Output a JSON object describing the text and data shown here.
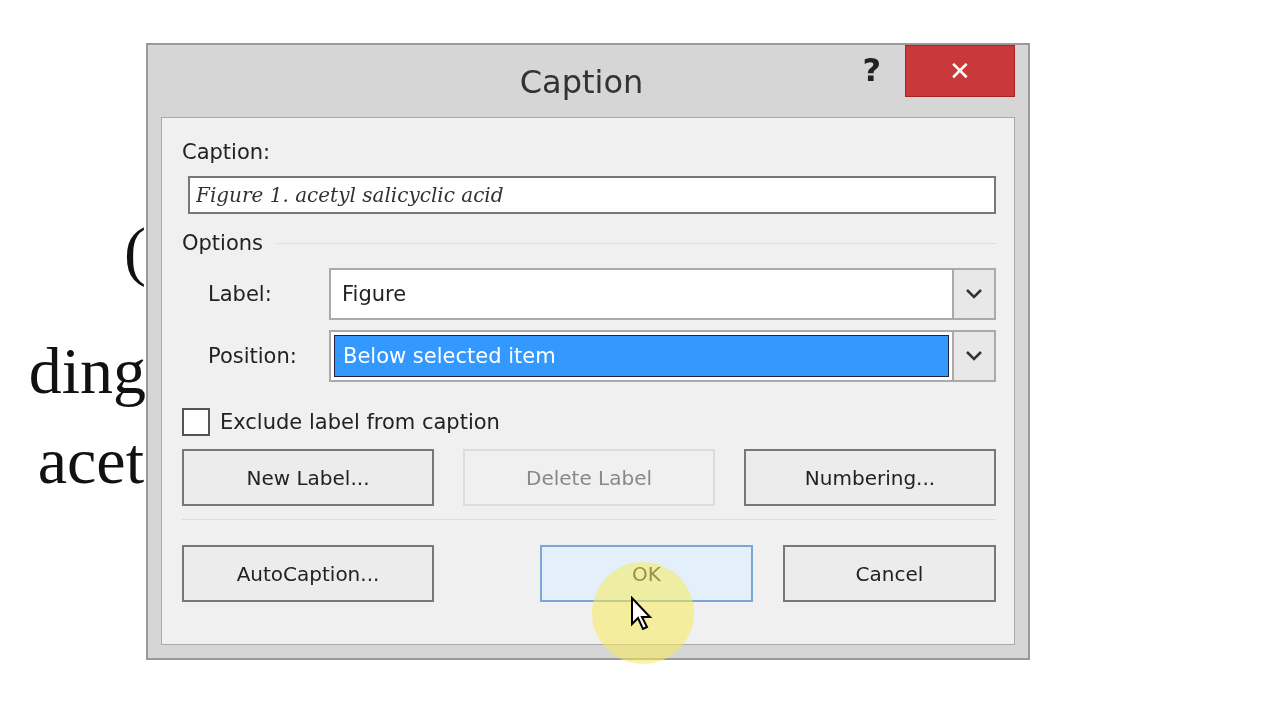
{
  "document": {
    "lines": [
      "(",
      "ding",
      "acet"
    ]
  },
  "window": {
    "title": "Caption",
    "help": "?",
    "close": "✕"
  },
  "caption": {
    "label": "Caption:",
    "value": "Figure 1. acetyl salicyclic acid"
  },
  "options": {
    "heading": "Options",
    "fields": [
      {
        "label": "Label:",
        "value": "Figure",
        "selected": false
      },
      {
        "label": "Position:",
        "value": "Below selected item",
        "selected": true
      }
    ],
    "exclude": {
      "label": "Exclude label from caption",
      "checked": false
    }
  },
  "buttons": [
    {
      "label": "New Label...",
      "disabled": false,
      "hovered": false
    },
    {
      "label": "Delete Label",
      "disabled": true,
      "hovered": false
    },
    {
      "label": "Numbering...",
      "disabled": false,
      "hovered": false
    }
  ],
  "footer_buttons": [
    {
      "label": "AutoCaption...",
      "disabled": false,
      "hovered": false
    },
    {
      "label": "OK",
      "disabled": false,
      "hovered": true
    },
    {
      "label": "Cancel",
      "disabled": false,
      "hovered": false
    }
  ]
}
